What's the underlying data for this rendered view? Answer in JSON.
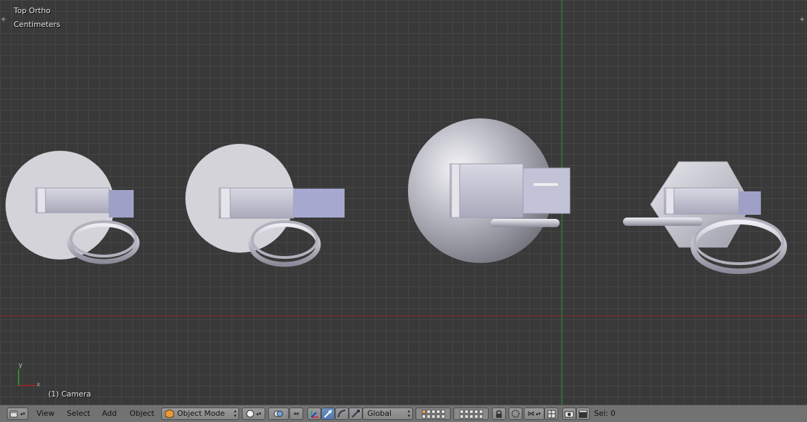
{
  "viewport": {
    "view_name": "Top Ortho",
    "units": "Centimeters",
    "active_object": "(1) Camera",
    "axis_x_label": "x",
    "axis_y_label": "y",
    "colors": {
      "background": "#393939",
      "grid": "#464646",
      "x_axis": "#8a2b2b",
      "y_axis": "#2f8a2f",
      "object": "#c9cbe0"
    }
  },
  "header": {
    "menus": [
      "View",
      "Select",
      "Add",
      "Object"
    ],
    "mode": "Object Mode",
    "transform_orientation": "Global",
    "selection_status": "Sel: 0",
    "icons": [
      "editor-type-icon",
      "viewport-shading-icon",
      "pivot-point-icon",
      "manipulator-icon",
      "translate-icon",
      "rotate-icon",
      "scale-icon",
      "layers-grid-icon",
      "lock-icon",
      "proportional-edit-icon",
      "snap-icon",
      "snap-element-icon",
      "render-icon",
      "clapper-icon"
    ]
  }
}
